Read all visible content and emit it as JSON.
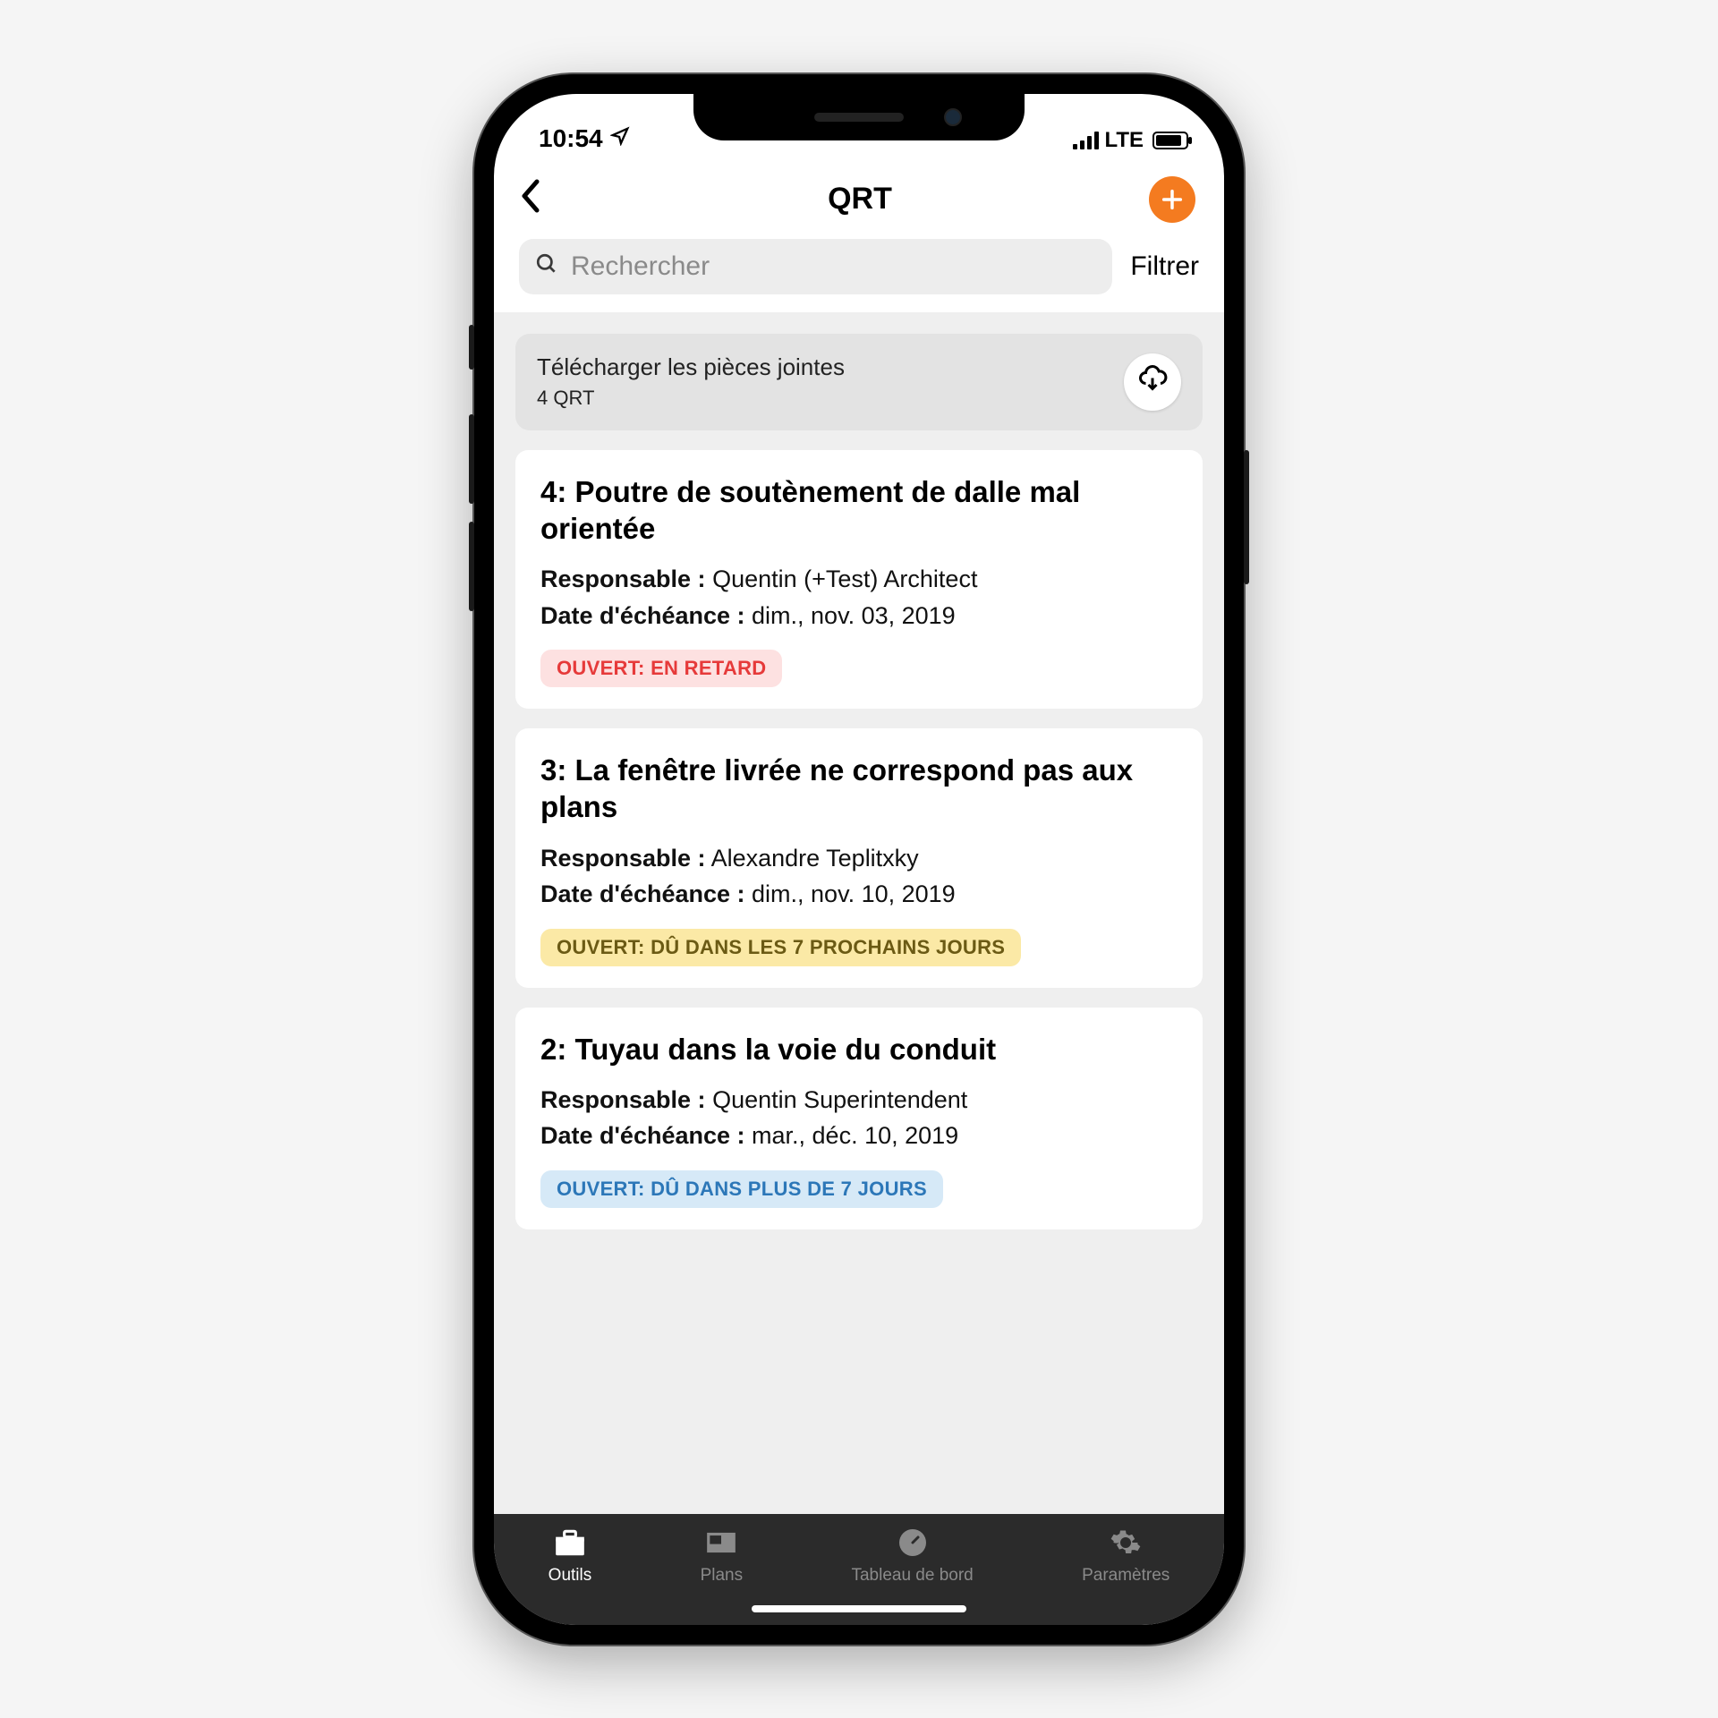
{
  "status": {
    "time": "10:54",
    "network": "LTE"
  },
  "header": {
    "title": "QRT"
  },
  "search": {
    "placeholder": "Rechercher",
    "filter_label": "Filtrer"
  },
  "download_banner": {
    "title": "Télécharger les pièces jointes",
    "subtitle": "4 QRT"
  },
  "labels": {
    "responsible": "Responsable :",
    "due": "Date d'échéance :"
  },
  "items": [
    {
      "title": "4: Poutre de soutènement de dalle mal orientée",
      "responsible": "Quentin (+Test) Architect",
      "due": "dim., nov. 03, 2019",
      "status_text": "OUVERT: EN RETARD",
      "status_class": "pill-red"
    },
    {
      "title": "3: La fenêtre livrée ne correspond pas aux plans",
      "responsible": "Alexandre Teplitxky",
      "due": "dim., nov. 10, 2019",
      "status_text": "OUVERT: DÛ DANS LES 7 PROCHAINS JOURS",
      "status_class": "pill-yellow"
    },
    {
      "title": "2: Tuyau dans la voie du conduit",
      "responsible": "Quentin Superintendent",
      "due": "mar., déc. 10, 2019",
      "status_text": "OUVERT: DÛ DANS PLUS DE 7 JOURS",
      "status_class": "pill-blue"
    }
  ],
  "tabs": [
    {
      "label": "Outils",
      "active": true
    },
    {
      "label": "Plans",
      "active": false
    },
    {
      "label": "Tableau de bord",
      "active": false
    },
    {
      "label": "Paramètres",
      "active": false
    }
  ]
}
